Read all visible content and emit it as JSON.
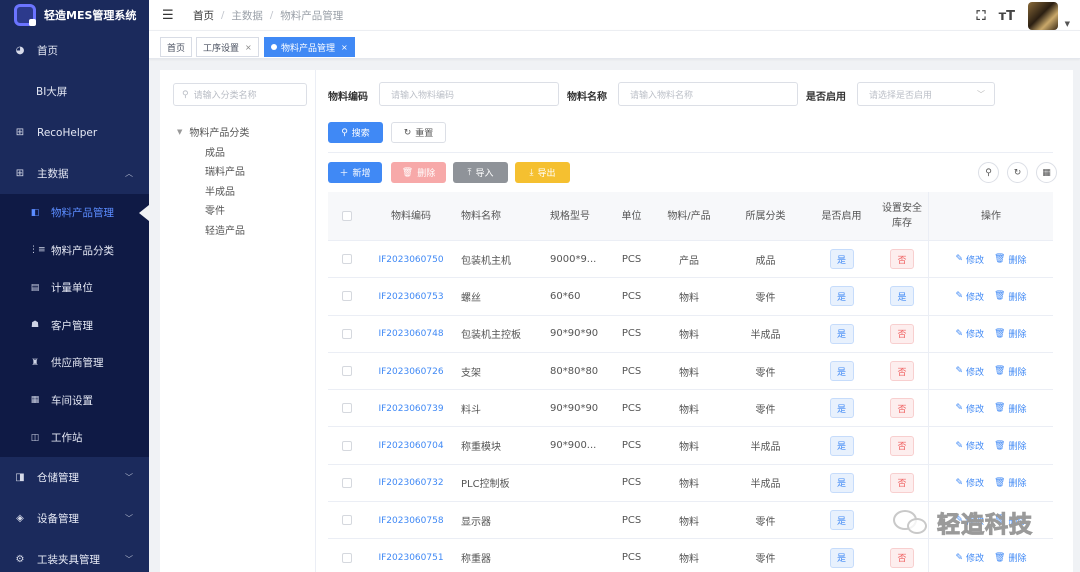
{
  "app": {
    "title": "轻造MES管理系统"
  },
  "sidebar": {
    "items": [
      {
        "label": "首页",
        "icon": "dashboard-icon",
        "glyph": "◕"
      },
      {
        "label": "BI大屏",
        "icon": "",
        "glyph": ""
      },
      {
        "label": "RecoHelper",
        "icon": "grid-icon",
        "glyph": "⊞"
      },
      {
        "label": "主数据",
        "icon": "grid-icon",
        "glyph": "⊞",
        "expanded": true
      }
    ],
    "sub_items": [
      {
        "label": "物料产品管理",
        "icon": "material-icon",
        "glyph": "◧",
        "active": true
      },
      {
        "label": "物料产品分类",
        "icon": "tree-icon",
        "glyph": "⋮≡"
      },
      {
        "label": "计量单位",
        "icon": "ruler-icon",
        "glyph": "▤"
      },
      {
        "label": "客户管理",
        "icon": "customer-icon",
        "glyph": "☗"
      },
      {
        "label": "供应商管理",
        "icon": "supplier-icon",
        "glyph": "♜"
      },
      {
        "label": "车间设置",
        "icon": "workshop-icon",
        "glyph": "▦"
      },
      {
        "label": "工作站",
        "icon": "workstation-icon",
        "glyph": "◫"
      }
    ],
    "bottom_items": [
      {
        "label": "仓储管理",
        "icon": "warehouse-icon",
        "glyph": "◨"
      },
      {
        "label": "设备管理",
        "icon": "device-icon",
        "glyph": "◈"
      },
      {
        "label": "工装夹具管理",
        "icon": "tooling-icon",
        "glyph": "⚙"
      }
    ]
  },
  "header": {
    "breadcrumb": [
      "首页",
      "主数据",
      "物料产品管理"
    ],
    "fullscreen_icon": "fullscreen-icon",
    "fontsize_icon": "font-size-icon",
    "fontsize_glyph": "тT"
  },
  "tags": [
    {
      "label": "首页",
      "closable": false,
      "active": false
    },
    {
      "label": "工序设置",
      "closable": true,
      "active": false
    },
    {
      "label": "物料产品管理",
      "closable": true,
      "active": true
    }
  ],
  "tree": {
    "search_placeholder": "请输入分类名称",
    "root": "物料产品分类",
    "children": [
      "成品",
      "瑞料产品",
      "半成品",
      "零件",
      "轻造产品"
    ]
  },
  "filters": {
    "code_label": "物料编码",
    "code_placeholder": "请输入物料编码",
    "name_label": "物料名称",
    "name_placeholder": "请输入物料名称",
    "enable_label": "是否启用",
    "enable_placeholder": "请选择是否启用",
    "search_btn": "搜索",
    "reset_btn": "重置"
  },
  "toolbar": {
    "add_btn": "新增",
    "delete_btn": "删除",
    "import_btn": "导入",
    "export_btn": "导出"
  },
  "table": {
    "headers": [
      "物料编码",
      "物料名称",
      "规格型号",
      "单位",
      "物料/产品",
      "所属分类",
      "是否启用",
      "设置安全库存",
      "操作"
    ],
    "edit_label": "修改",
    "delete_label": "删除",
    "rows": [
      {
        "code": "IF2023060750",
        "name": "包装机主机",
        "spec": "9000*9...",
        "unit": "PCS",
        "type": "产品",
        "category": "成品",
        "enabled": "是",
        "safe": "否"
      },
      {
        "code": "IF2023060753",
        "name": "螺丝",
        "spec": "60*60",
        "unit": "PCS",
        "type": "物料",
        "category": "零件",
        "enabled": "是",
        "safe": "是"
      },
      {
        "code": "IF2023060748",
        "name": "包装机主控板",
        "spec": "90*90*90",
        "unit": "PCS",
        "type": "物料",
        "category": "半成品",
        "enabled": "是",
        "safe": "否"
      },
      {
        "code": "IF2023060726",
        "name": "支架",
        "spec": "80*80*80",
        "unit": "PCS",
        "type": "物料",
        "category": "零件",
        "enabled": "是",
        "safe": "否"
      },
      {
        "code": "IF2023060739",
        "name": "料斗",
        "spec": "90*90*90",
        "unit": "PCS",
        "type": "物料",
        "category": "零件",
        "enabled": "是",
        "safe": "否"
      },
      {
        "code": "IF2023060704",
        "name": "称重模块",
        "spec": "90*900...",
        "unit": "PCS",
        "type": "物料",
        "category": "半成品",
        "enabled": "是",
        "safe": "否"
      },
      {
        "code": "IF2023060732",
        "name": "PLC控制板",
        "spec": "",
        "unit": "PCS",
        "type": "物料",
        "category": "半成品",
        "enabled": "是",
        "safe": "否"
      },
      {
        "code": "IF2023060758",
        "name": "显示器",
        "spec": "",
        "unit": "PCS",
        "type": "物料",
        "category": "零件",
        "enabled": "是",
        "safe": ""
      },
      {
        "code": "IF2023060751",
        "name": "称重器",
        "spec": "",
        "unit": "PCS",
        "type": "物料",
        "category": "零件",
        "enabled": "是",
        "safe": "否"
      }
    ]
  },
  "watermark": {
    "text": "轻造科技"
  },
  "colors": {
    "sidebar": "#1b2a5c",
    "primary": "#4089f5",
    "danger": "#f06060",
    "warning": "#f5c030"
  }
}
